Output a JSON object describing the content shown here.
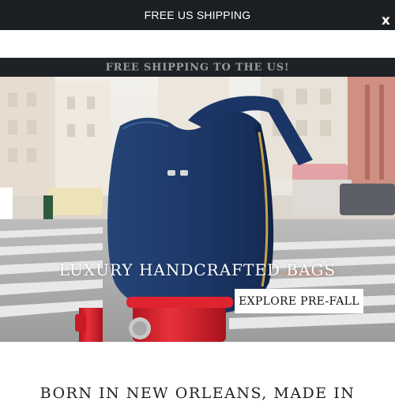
{
  "top_banner": {
    "text": "FREE US SHIPPING",
    "close_label": "x"
  },
  "promo_bar": {
    "text": "FREE SHIPPING TO THE US!"
  },
  "hero": {
    "title": "LUXURY HANDCRAFTED BAGS",
    "cta_label": "EXPLORE PRE-FALL"
  },
  "section": {
    "heading": "BORN IN NEW ORLEANS, MADE IN"
  },
  "colors": {
    "banner_bg": "#1c1f22",
    "promo_bg": "#1e2125",
    "bag_blue": "#1d3b6e",
    "hydrant_red": "#d41f2b"
  }
}
